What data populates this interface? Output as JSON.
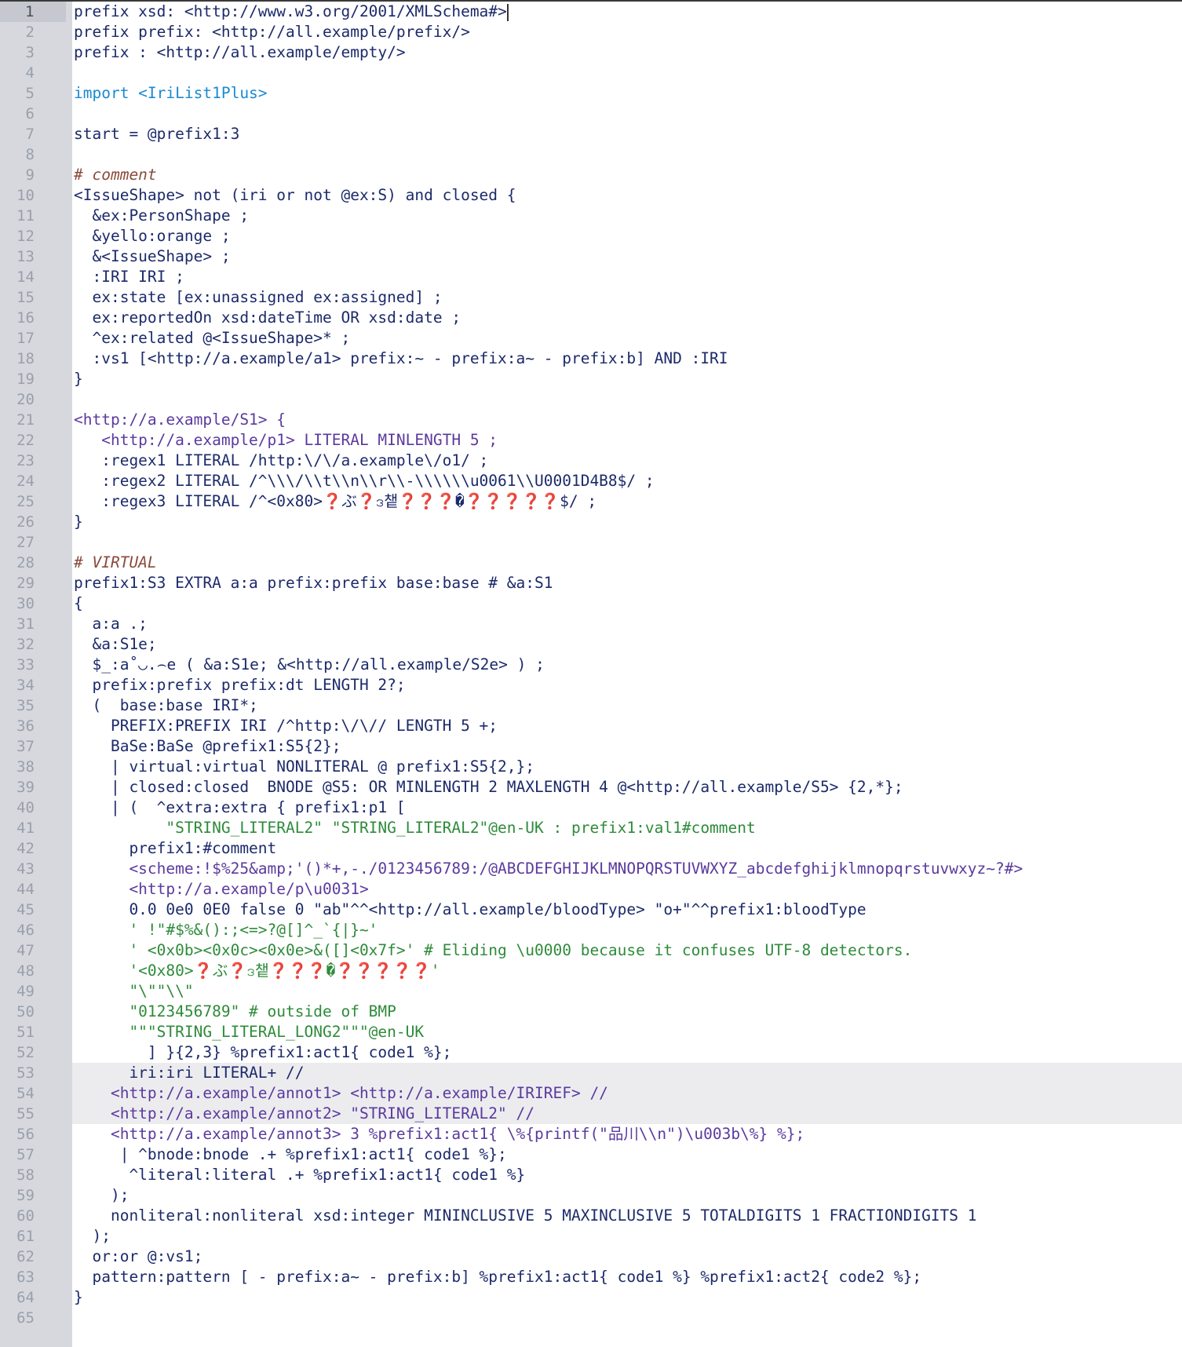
{
  "editor": {
    "lines": [
      {
        "n": "1",
        "t": "prefix xsd: <http://www.w3.org/2001/XMLSchema#>",
        "cur": true
      },
      {
        "n": "2",
        "t": "prefix prefix: <http://all.example/prefix/>"
      },
      {
        "n": "3",
        "t": "prefix : <http://all.example/empty/>"
      },
      {
        "n": "4",
        "t": ""
      },
      {
        "n": "5",
        "t": "import <IriList1Plus>"
      },
      {
        "n": "6",
        "t": ""
      },
      {
        "n": "7",
        "t": "start = @prefix1:3"
      },
      {
        "n": "8",
        "t": ""
      },
      {
        "n": "9",
        "t": "# comment"
      },
      {
        "n": "10",
        "t": "<IssueShape> not (iri or not @ex:S) and closed {"
      },
      {
        "n": "11",
        "t": "  &ex:PersonShape ;"
      },
      {
        "n": "12",
        "t": "  &yello:orange ;"
      },
      {
        "n": "13",
        "t": "  &<IssueShape> ;"
      },
      {
        "n": "14",
        "t": "  :IRI IRI ;"
      },
      {
        "n": "15",
        "t": "  ex:state [ex:unassigned ex:assigned] ;"
      },
      {
        "n": "16",
        "t": "  ex:reportedOn xsd:dateTime OR xsd:date ;"
      },
      {
        "n": "17",
        "t": "  ^ex:related @<IssueShape>* ;"
      },
      {
        "n": "18",
        "t": "  :vs1 [<http://a.example/a1> prefix:~ - prefix:a~ - prefix:b] AND :IRI"
      },
      {
        "n": "19",
        "t": "}"
      },
      {
        "n": "20",
        "t": ""
      },
      {
        "n": "21",
        "t": "<http://a.example/S1> {"
      },
      {
        "n": "22",
        "t": "   <http://a.example/p1> LITERAL MINLENGTH 5 ;"
      },
      {
        "n": "23",
        "t": "   :regex1 LITERAL /http:\\/\\/a.example\\/o1/ ;"
      },
      {
        "n": "24",
        "t": "   :regex2 LITERAL /^\\\\\\/\\\\t\\\\n\\\\r\\\\-\\\\\\\\\\\\u0061\\\\U0001D4B8$/ ;"
      },
      {
        "n": "25",
        "t": "   :regex3 LITERAL /^<0x80>❓ぶ❓ဒ챝❓❓❓�❓❓❓❓❓$/ ;"
      },
      {
        "n": "26",
        "t": "}"
      },
      {
        "n": "27",
        "t": ""
      },
      {
        "n": "28",
        "t": "# VIRTUAL"
      },
      {
        "n": "29",
        "t": "prefix1:S3 EXTRA a:a prefix:prefix base:base # &a:S1"
      },
      {
        "n": "30",
        "t": "{"
      },
      {
        "n": "31",
        "t": "  a:a .;"
      },
      {
        "n": "32",
        "t": "  &a:S1e;"
      },
      {
        "n": "33",
        "t": "  $_:a˚◡.⌢e ( &a:S1e; &<http://all.example/S2e> ) ;"
      },
      {
        "n": "34",
        "t": "  prefix:prefix prefix:dt LENGTH 2?;"
      },
      {
        "n": "35",
        "t": "  (  base:base IRI*;"
      },
      {
        "n": "36",
        "t": "    PREFIX:PREFIX IRI /^http:\\/\\// LENGTH 5 +;"
      },
      {
        "n": "37",
        "t": "    BaSe:BaSe @prefix1:S5{2};"
      },
      {
        "n": "38",
        "t": "    | virtual:virtual NONLITERAL @ prefix1:S5{2,};"
      },
      {
        "n": "39",
        "t": "    | closed:closed  BNODE @S5: OR MINLENGTH 2 MAXLENGTH 4 @<http://all.example/S5> {2,*};"
      },
      {
        "n": "40",
        "t": "    | (  ^extra:extra { prefix1:p1 ["
      },
      {
        "n": "41",
        "t": "          \"STRING_LITERAL2\" \"STRING_LITERAL2\"@en-UK : prefix1:val1#comment"
      },
      {
        "n": "42",
        "t": "      prefix1:#comment"
      },
      {
        "n": "43",
        "t": "      <scheme:!$%25&amp;'()*+,-./0123456789:/@ABCDEFGHIJKLMNOPQRSTUVWXYZ_abcdefghijklmnopqrstuvwxyz~?#>"
      },
      {
        "n": "44",
        "t": "      <http://a.example/p\\u0031>"
      },
      {
        "n": "45",
        "t": "      0.0 0e0 0E0 false 0 \"ab\"^^<http://all.example/bloodType> \"o+\"^^prefix1:bloodType"
      },
      {
        "n": "46",
        "t": "      ' !\"#$%&():;<=>?@[]^_`{|}~'"
      },
      {
        "n": "47",
        "t": "      ' <0x0b><0x0c><0x0e>&([]<0x7f>' # Eliding \\u0000 because it confuses UTF-8 detectors."
      },
      {
        "n": "48",
        "t": "      '<0x80>❓ぶ❓ဒ챝❓❓❓�❓❓❓❓❓'"
      },
      {
        "n": "49",
        "t": "      \"\\\"\"\\\\\""
      },
      {
        "n": "50",
        "t": "      \"0123456789\" # outside of BMP"
      },
      {
        "n": "51",
        "t": "      \"\"\"STRING_LITERAL_LONG2\"\"\"@en-UK"
      },
      {
        "n": "52",
        "t": "        ] }{2,3} %prefix1:act1{ code1 %};"
      },
      {
        "n": "53",
        "t": "      iri:iri LITERAL+ //",
        "hl": true
      },
      {
        "n": "54",
        "t": "    <http://a.example/annot1> <http://a.example/IRIREF> //",
        "hl": true
      },
      {
        "n": "55",
        "t": "    <http://a.example/annot2> \"STRING_LITERAL2\" //",
        "hl": true
      },
      {
        "n": "56",
        "t": "    <http://a.example/annot3> 3 %prefix1:act1{ \\%{printf(\"品川\\\\n\")\\u003b\\%} %};"
      },
      {
        "n": "57",
        "t": "     | ^bnode:bnode .+ %prefix1:act1{ code1 %};"
      },
      {
        "n": "58",
        "t": "      ^literal:literal .+ %prefix1:act1{ code1 %}"
      },
      {
        "n": "59",
        "t": "    );"
      },
      {
        "n": "60",
        "t": "    nonliteral:nonliteral xsd:integer MININCLUSIVE 5 MAXINCLUSIVE 5 TOTALDIGITS 1 FRACTIONDIGITS 1"
      },
      {
        "n": "61",
        "t": "  );"
      },
      {
        "n": "62",
        "t": "  or:or @:vs1;"
      },
      {
        "n": "63",
        "t": "  pattern:pattern [ - prefix:a~ - prefix:b] %prefix1:act1{ code1 %} %prefix1:act2{ code2 %};"
      },
      {
        "n": "64",
        "t": "}"
      },
      {
        "n": "65",
        "t": ""
      }
    ]
  }
}
